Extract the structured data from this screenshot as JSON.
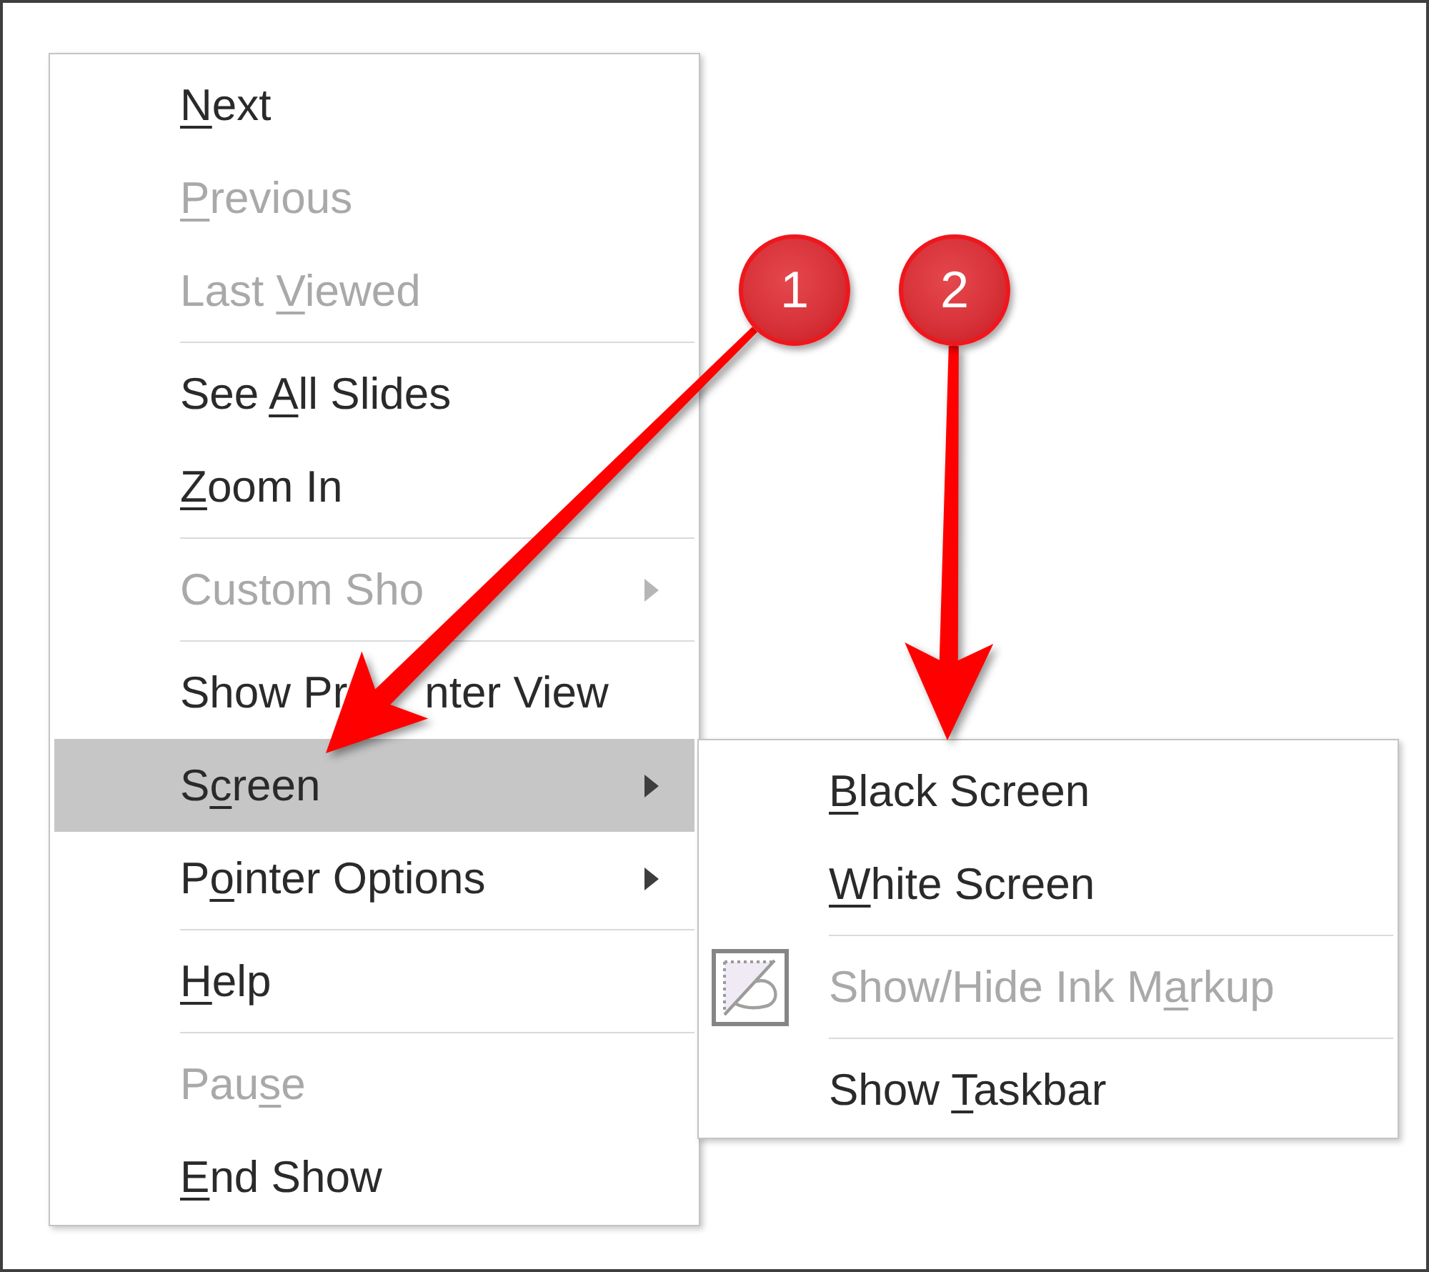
{
  "menu": {
    "items": [
      {
        "kind": "command",
        "label": [
          {
            "text": "N",
            "underlined": true
          },
          {
            "text": "ext",
            "underlined": false
          }
        ],
        "disabled": false,
        "selected": false,
        "has_submenu": false
      },
      {
        "kind": "command",
        "label": [
          {
            "text": "P",
            "underlined": true
          },
          {
            "text": "revious",
            "underlined": false
          }
        ],
        "disabled": true,
        "selected": false,
        "has_submenu": false
      },
      {
        "kind": "command",
        "label": [
          {
            "text": "Last ",
            "underlined": false
          },
          {
            "text": "V",
            "underlined": true
          },
          {
            "text": "iewed",
            "underlined": false
          }
        ],
        "disabled": true,
        "selected": false,
        "has_submenu": false
      },
      {
        "kind": "separator"
      },
      {
        "kind": "command",
        "label": [
          {
            "text": "See ",
            "underlined": false
          },
          {
            "text": "A",
            "underlined": true
          },
          {
            "text": "ll Slides",
            "underlined": false
          }
        ],
        "disabled": false,
        "selected": false,
        "has_submenu": false
      },
      {
        "kind": "command",
        "label": [
          {
            "text": "Z",
            "underlined": true
          },
          {
            "text": "oom In",
            "underlined": false
          }
        ],
        "disabled": false,
        "selected": false,
        "has_submenu": false
      },
      {
        "kind": "separator"
      },
      {
        "kind": "command",
        "label": [
          {
            "text": "Custom Sho",
            "underlined": false
          }
        ],
        "disabled": true,
        "selected": false,
        "has_submenu": true
      },
      {
        "kind": "separator"
      },
      {
        "kind": "command",
        "label": [
          {
            "text": "Show Pr",
            "underlined": false
          },
          {
            "text": "nter View",
            "underlined": false
          }
        ],
        "disabled": false,
        "selected": false,
        "has_submenu": false
      },
      {
        "kind": "command",
        "label": [
          {
            "text": "S",
            "underlined": false
          },
          {
            "text": "c",
            "underlined": true
          },
          {
            "text": "reen",
            "underlined": false
          }
        ],
        "disabled": false,
        "selected": true,
        "has_submenu": true
      },
      {
        "kind": "command",
        "label": [
          {
            "text": "P",
            "underlined": false
          },
          {
            "text": "o",
            "underlined": true
          },
          {
            "text": "inter Options",
            "underlined": false
          }
        ],
        "disabled": false,
        "selected": false,
        "has_submenu": true
      },
      {
        "kind": "separator"
      },
      {
        "kind": "command",
        "label": [
          {
            "text": "H",
            "underlined": true
          },
          {
            "text": "elp",
            "underlined": false
          }
        ],
        "disabled": false,
        "selected": false,
        "has_submenu": false
      },
      {
        "kind": "separator"
      },
      {
        "kind": "command",
        "label": [
          {
            "text": "Pau",
            "underlined": false
          },
          {
            "text": "s",
            "underlined": true
          },
          {
            "text": "e",
            "underlined": false
          }
        ],
        "disabled": true,
        "selected": false,
        "has_submenu": false
      },
      {
        "kind": "command",
        "label": [
          {
            "text": "E",
            "underlined": true
          },
          {
            "text": "nd Show",
            "underlined": false
          }
        ],
        "disabled": false,
        "selected": false,
        "has_submenu": false
      }
    ]
  },
  "submenu": {
    "items": [
      {
        "kind": "command",
        "label": [
          {
            "text": "B",
            "underlined": true
          },
          {
            "text": "lack Screen",
            "underlined": false
          }
        ],
        "disabled": false,
        "selected": false,
        "has_icon": false
      },
      {
        "kind": "command",
        "label": [
          {
            "text": "W",
            "underlined": true
          },
          {
            "text": "hite Screen",
            "underlined": false
          }
        ],
        "disabled": false,
        "selected": false,
        "has_icon": false
      },
      {
        "kind": "separator"
      },
      {
        "kind": "command",
        "label": [
          {
            "text": "Show/Hide Ink M",
            "underlined": false
          },
          {
            "text": "a",
            "underlined": true
          },
          {
            "text": "rkup",
            "underlined": false
          }
        ],
        "disabled": true,
        "selected": false,
        "has_icon": true
      },
      {
        "kind": "separator"
      },
      {
        "kind": "command",
        "label": [
          {
            "text": "Show ",
            "underlined": false
          },
          {
            "text": "T",
            "underlined": true
          },
          {
            "text": "askbar",
            "underlined": false
          }
        ],
        "disabled": false,
        "selected": false,
        "has_icon": false
      }
    ]
  },
  "callouts": [
    {
      "number": "1"
    },
    {
      "number": "2"
    }
  ]
}
